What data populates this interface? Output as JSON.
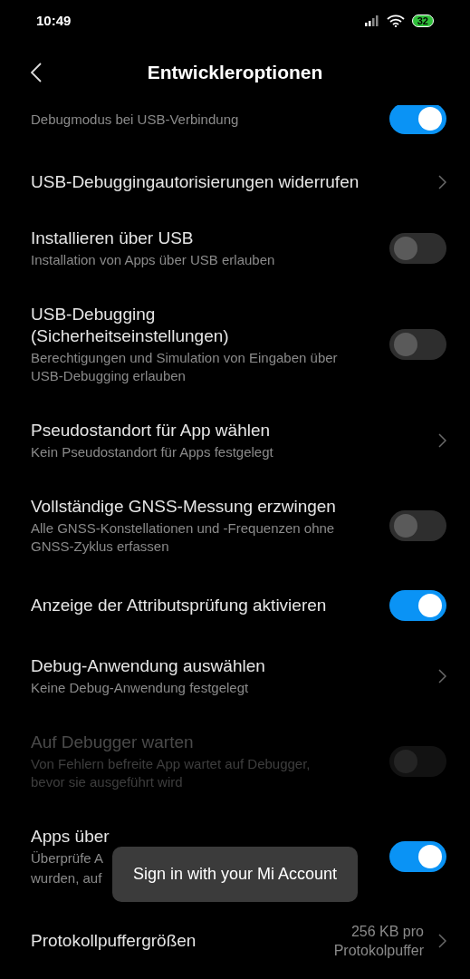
{
  "status_bar": {
    "time": "10:49",
    "battery": "32"
  },
  "header": {
    "title": "Entwickleroptionen"
  },
  "items": [
    {
      "kind": "toggle",
      "subtitle": [
        "Debugmodus bei USB-Verbindung"
      ],
      "on": true,
      "disabled": false
    },
    {
      "kind": "link",
      "title": "USB-Debuggingautorisierungen widerrufen"
    },
    {
      "kind": "toggle",
      "title": "Installieren über USB",
      "subtitle": [
        "Installation von Apps über USB erlauben"
      ],
      "on": false,
      "disabled": false
    },
    {
      "kind": "toggle",
      "title": "USB-Debugging (Sicherheitseinstellungen)",
      "subtitle": [
        "Berechtigungen und Simulation von Eingaben über USB-Debugging erlauben"
      ],
      "on": false,
      "disabled": false
    },
    {
      "kind": "link",
      "title": "Pseudostandort für App wählen",
      "subtitle": [
        "Kein Pseudostandort für Apps festgelegt"
      ]
    },
    {
      "kind": "toggle",
      "title": "Vollständige GNSS-Messung erzwingen",
      "subtitle": [
        "Alle GNSS-Konstellationen und -Frequenzen ohne GNSS-Zyklus erfassen"
      ],
      "on": false,
      "disabled": false
    },
    {
      "kind": "toggle",
      "title": "Anzeige der Attributsprüfung aktivieren",
      "on": true,
      "disabled": false
    },
    {
      "kind": "link",
      "title": "Debug-Anwendung auswählen",
      "subtitle": [
        "Keine Debug-Anwendung festgelegt"
      ]
    },
    {
      "kind": "toggle",
      "title": "Auf Debugger warten",
      "subtitle": [
        "Von Fehlern befreite App wartet auf Debugger, bevor sie ausgeführt wird"
      ],
      "on": false,
      "disabled": true
    },
    {
      "kind": "toggle",
      "title": "Apps über",
      "subtitle": [
        "Überprüfe A",
        "wurden, auf"
      ],
      "on": true,
      "disabled": false
    },
    {
      "kind": "link",
      "title": "Protokollpuffergrößen",
      "value": "256 KB pro Protokolpuffer"
    }
  ],
  "toast": {
    "text": "Sign in with your Mi Account"
  }
}
